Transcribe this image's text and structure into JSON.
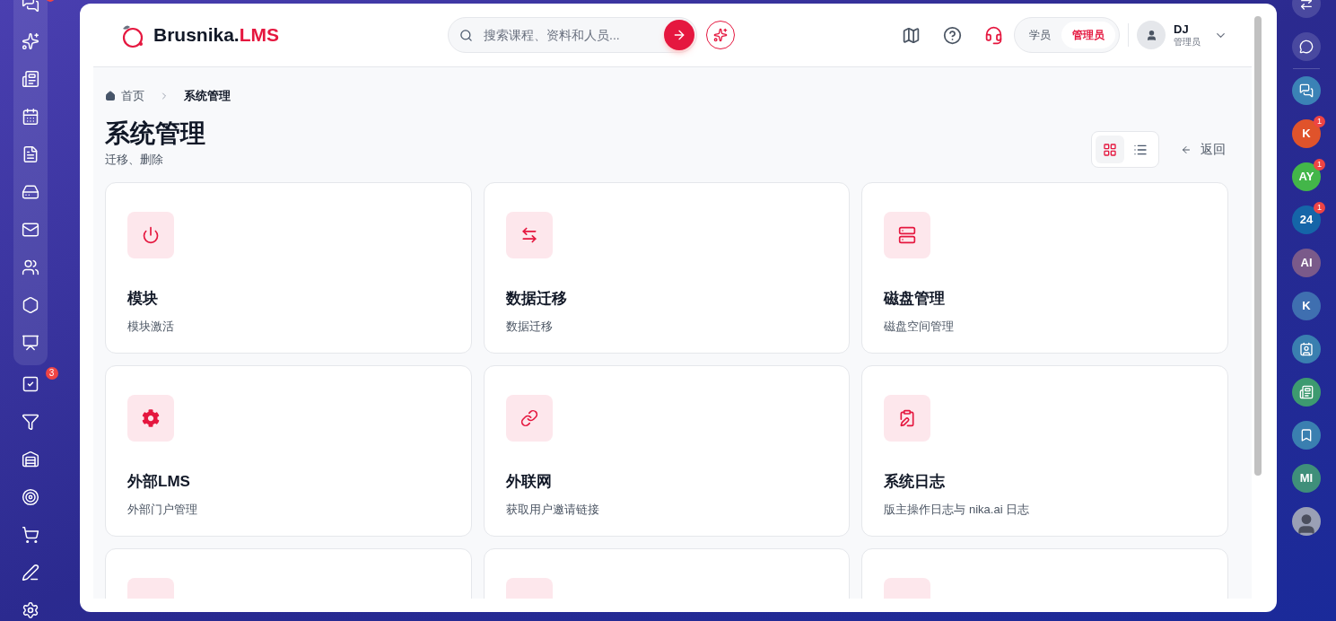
{
  "sidebar": {
    "panel": [
      {
        "kind": "nav",
        "dot": true
      },
      {
        "kind": "nav"
      },
      {
        "kind": "nav"
      },
      {
        "kind": "nav"
      },
      {
        "kind": "nav"
      },
      {
        "kind": "nav"
      },
      {
        "kind": "nav"
      },
      {
        "kind": "nav"
      },
      {
        "kind": "nav"
      },
      {
        "kind": "nav"
      }
    ],
    "items": [
      {
        "kind": "nav",
        "badge": "3"
      },
      {
        "kind": "nav"
      },
      {
        "kind": "nav"
      },
      {
        "kind": "nav"
      },
      {
        "kind": "nav"
      },
      {
        "kind": "nav"
      },
      {
        "kind": "nav"
      }
    ]
  },
  "header": {
    "logo": {
      "name": "Brusnika.",
      "accent": "LMS"
    },
    "search": {
      "placeholder": "搜索课程、资料和人员..."
    },
    "roles": [
      {
        "label": "学员",
        "selected": false
      },
      {
        "label": "管理员",
        "selected": true
      }
    ],
    "user": {
      "initials": "DJ",
      "role": "管理员"
    }
  },
  "breadcrumb": {
    "home": "首页",
    "current": "系统管理"
  },
  "page": {
    "title": "系统管理",
    "subtitle": "迁移、删除",
    "views": [
      {
        "kind": "grid",
        "selected": true
      },
      {
        "kind": "list",
        "selected": false
      }
    ],
    "back": "返回"
  },
  "cards": [
    {
      "kind": "full",
      "title": "模块",
      "description": "模块激活"
    },
    {
      "kind": "full",
      "title": "数据迁移",
      "description": "数据迁移"
    },
    {
      "kind": "full",
      "title": "磁盘管理",
      "description": "磁盘空间管理"
    },
    {
      "kind": "full",
      "title": "外部LMS",
      "description": "外部门户管理"
    },
    {
      "kind": "full",
      "title": "外联网",
      "description": "获取用户邀请链接"
    },
    {
      "kind": "full",
      "title": "系统日志",
      "description": "版主操作日志与 nika.ai 日志"
    },
    {
      "kind": "partial"
    },
    {
      "kind": "partial"
    },
    {
      "kind": "partial"
    }
  ],
  "dock": [
    {
      "kind": "icon"
    },
    {
      "kind": "icon"
    },
    {
      "kind": "divider"
    },
    {
      "kind": "icon",
      "color": "#3b82b6"
    },
    {
      "kind": "letter",
      "label": "K",
      "color": "#e0532b",
      "badge": "1"
    },
    {
      "kind": "letter",
      "label": "AY",
      "color": "#43b649",
      "badge": "1"
    },
    {
      "kind": "letter",
      "label": "24",
      "color": "#1565a8",
      "badge": "1"
    },
    {
      "kind": "letter",
      "label": "AI",
      "color": "#7a5a8a"
    },
    {
      "kind": "letter",
      "label": "K",
      "color": "#3f6fb0"
    },
    {
      "kind": "icon",
      "color": "#3a7fb0"
    },
    {
      "kind": "icon",
      "color": "#3d9a70"
    },
    {
      "kind": "icon",
      "color": "#3a7fb0"
    },
    {
      "kind": "letter",
      "label": "MI",
      "color": "#3f8f7a"
    },
    {
      "kind": "avatar"
    }
  ]
}
